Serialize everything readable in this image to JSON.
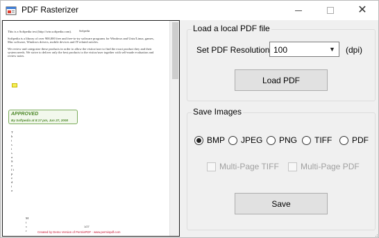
{
  "window": {
    "title": "PDF Rasterizer",
    "minimize_icon": "minimize-icon",
    "maximize_icon": "maximize-icon",
    "close_glyph": "✕"
  },
  "preview": {
    "top_label": "Softpedia",
    "lines": [
      "This is a Softpedia test (http://win.softpedia.com).",
      "Softpedia is a library of over 900,000 free and free-to-try software programs for Windows and Unix/Linux, games,",
      "Mac software, Windows drivers, mobile devices and IT-related articles.",
      "We review and categorize these products in order to allow the visitor/user to find the exact product they and their",
      "system needs. We strive to deliver only the best products to the visitor/user together with self-made evaluation and",
      "review notes."
    ],
    "stamp_title": "APPROVED",
    "stamp_sub": "By Softpedia at 8:17 pm, Jun 27, 2008",
    "vertical_text": "T h i s   i s   a   S o f t p e d i a",
    "vertical_text_2": "M i c r",
    "page_number": "1/27",
    "footer": "Created by Demo Version of PermisPDF  -  www.permispdf.com"
  },
  "load_group": {
    "legend": "Load a local PDF file",
    "resolution_label": "Set PDF Resolution:",
    "resolution_value": "100",
    "dpi_label": "(dpi)",
    "load_button": "Load PDF"
  },
  "save_group": {
    "legend": "Save Images",
    "formats": [
      {
        "label": "BMP",
        "selected": true
      },
      {
        "label": "JPEG",
        "selected": false
      },
      {
        "label": "PNG",
        "selected": false
      },
      {
        "label": "TIFF",
        "selected": false
      },
      {
        "label": "PDF",
        "selected": false
      }
    ],
    "multi_tiff": "Multi-Page TIFF",
    "multi_pdf": "Multi-Page PDF",
    "save_button": "Save"
  },
  "colors": {
    "stamp_green": "#4f8a2b",
    "footer_red": "#c8102e",
    "window_bg": "#f0f0f0"
  }
}
